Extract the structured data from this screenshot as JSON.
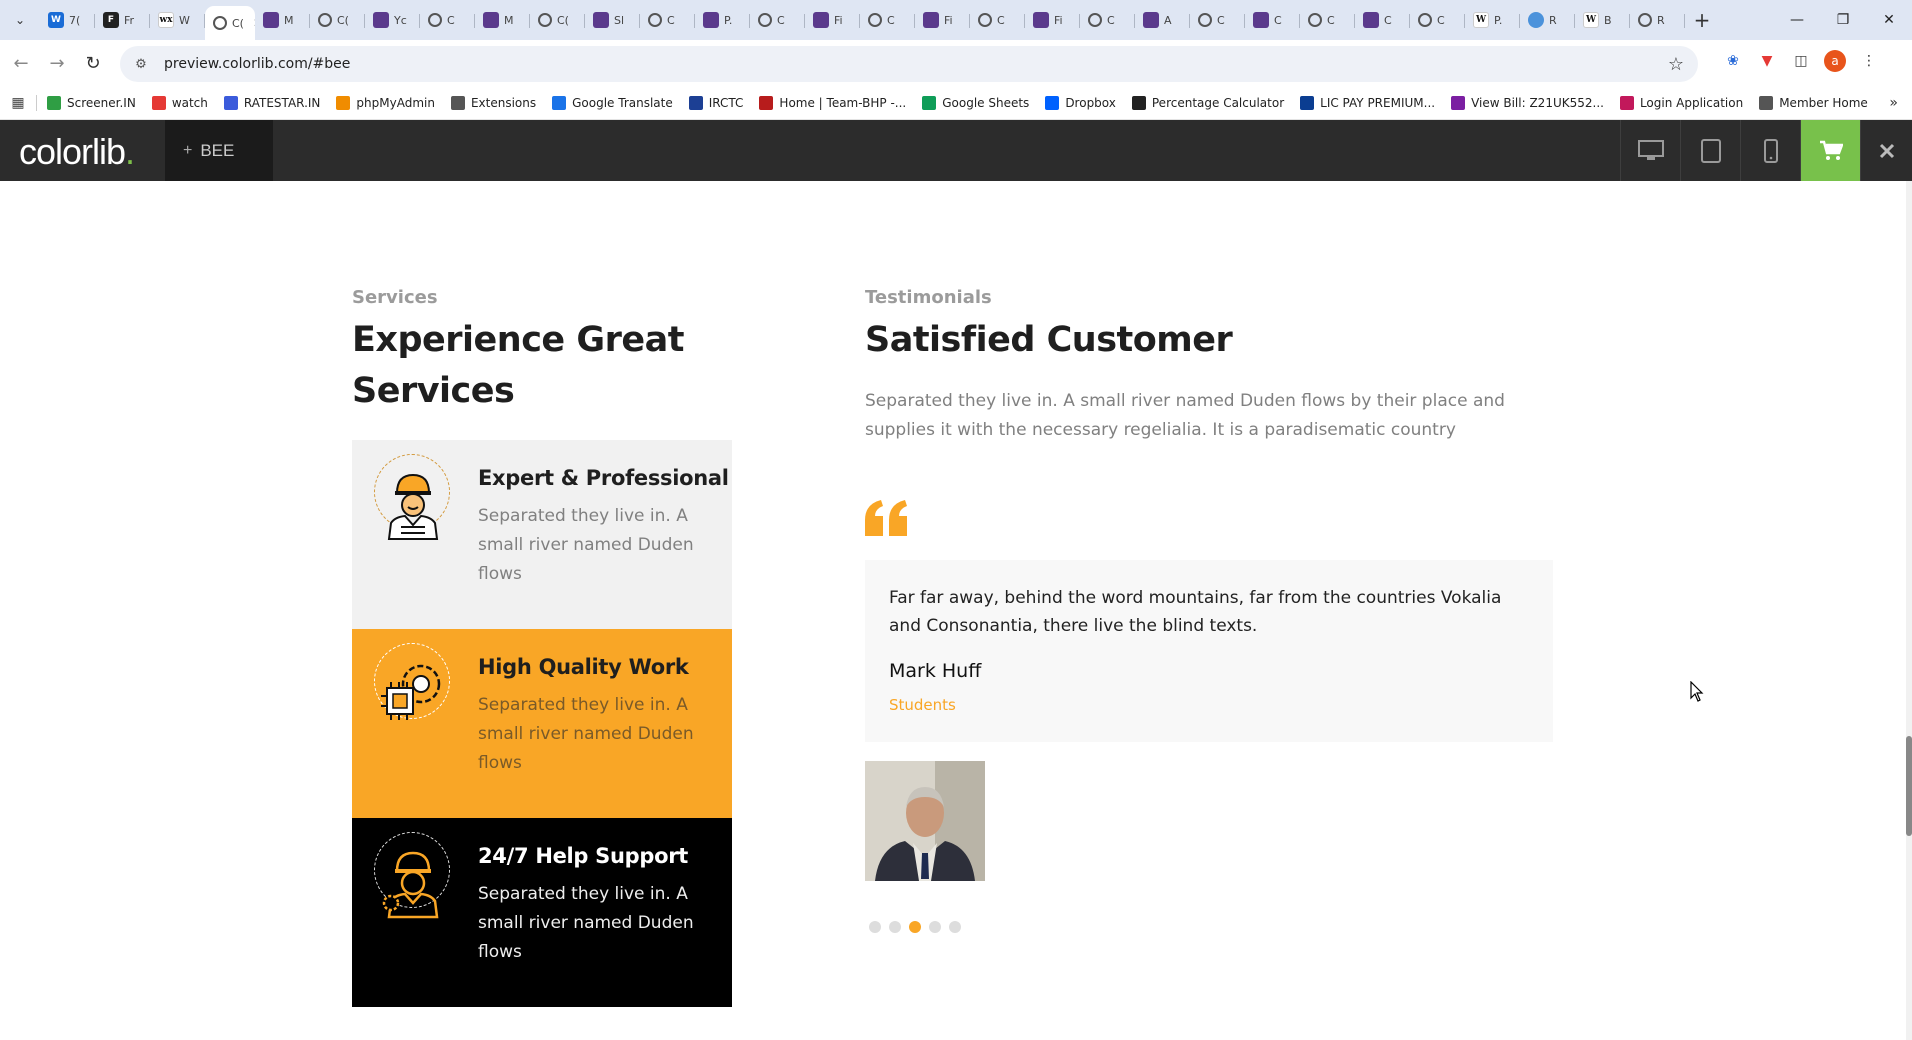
{
  "browser": {
    "tabs": [
      {
        "label": "7(",
        "icon": "outlook-icon"
      },
      {
        "label": "Fr",
        "icon": "feedly-icon"
      },
      {
        "label": "W",
        "icon": "wix-icon"
      },
      {
        "label": "C(",
        "icon": "colorlib-icon",
        "active": true
      },
      {
        "label": "M",
        "icon": "colorlib-icon"
      },
      {
        "label": "C(",
        "icon": "globe-icon"
      },
      {
        "label": "Yc",
        "icon": "colorlib-icon"
      },
      {
        "label": "C",
        "icon": "globe-icon"
      },
      {
        "label": "M",
        "icon": "colorlib-icon"
      },
      {
        "label": "C(",
        "icon": "globe-icon"
      },
      {
        "label": "Sl",
        "icon": "colorlib-icon"
      },
      {
        "label": "C",
        "icon": "globe-icon"
      },
      {
        "label": "P.",
        "icon": "colorlib-icon"
      },
      {
        "label": "C",
        "icon": "globe-icon"
      },
      {
        "label": "Fi",
        "icon": "colorlib-icon"
      },
      {
        "label": "C",
        "icon": "globe-icon"
      },
      {
        "label": "Fi",
        "icon": "colorlib-icon"
      },
      {
        "label": "C",
        "icon": "globe-icon"
      },
      {
        "label": "Fi",
        "icon": "colorlib-icon"
      },
      {
        "label": "C",
        "icon": "globe-icon"
      },
      {
        "label": "A",
        "icon": "colorlib-icon"
      },
      {
        "label": "C",
        "icon": "globe-icon"
      },
      {
        "label": "C",
        "icon": "colorlib-icon"
      },
      {
        "label": "C",
        "icon": "globe-icon"
      },
      {
        "label": "C",
        "icon": "colorlib-icon"
      },
      {
        "label": "C",
        "icon": "globe-icon"
      },
      {
        "label": "P.",
        "icon": "wikipedia-icon"
      },
      {
        "label": "R",
        "icon": "un-icon"
      },
      {
        "label": "B",
        "icon": "wikipedia-icon"
      },
      {
        "label": "R",
        "icon": "globe-icon"
      }
    ],
    "url": "preview.colorlib.com/#bee",
    "avatar_letter": "a",
    "bookmarks": [
      {
        "label": "Screener.IN",
        "color": "#2f9e44"
      },
      {
        "label": "watch",
        "color": "#e53935"
      },
      {
        "label": "RATESTAR.IN",
        "color": "#3b5bdb"
      },
      {
        "label": "phpMyAdmin",
        "color": "#f08c00"
      },
      {
        "label": "Extensions",
        "color": "#555555"
      },
      {
        "label": "Google Translate",
        "color": "#1a73e8"
      },
      {
        "label": "IRCTC",
        "color": "#1c3f94"
      },
      {
        "label": "Home | Team-BHP -...",
        "color": "#b71c1c"
      },
      {
        "label": "Google Sheets",
        "color": "#0f9d58"
      },
      {
        "label": "Dropbox",
        "color": "#0061fe"
      },
      {
        "label": "Percentage Calculator",
        "color": "#222222"
      },
      {
        "label": "LIC PAY PREMIUM...",
        "color": "#0b3d91"
      },
      {
        "label": "View Bill: Z21UK552...",
        "color": "#7b1fa2"
      },
      {
        "label": "Login Application",
        "color": "#c2185b"
      },
      {
        "label": "Member Home",
        "color": "#555555"
      }
    ]
  },
  "preview_bar": {
    "logo": "colorlib",
    "logo_dot": ".",
    "theme_name": "BEE",
    "theme_plus": "+",
    "accent": "#78c14b"
  },
  "services": {
    "subtitle": "Services",
    "title_line1": "Experience Great",
    "title_line2": "Services",
    "items": [
      {
        "title": "Expert & Professional",
        "text": "Separated they live in. A small river named Duden flows"
      },
      {
        "title": "High Quality Work",
        "text": "Separated they live in. A small river named Duden flows"
      },
      {
        "title": "24/7 Help Support",
        "text": "Separated they live in. A small river named Duden flows"
      }
    ]
  },
  "testimonials": {
    "subtitle": "Testimonials",
    "title": "Satisfied Customer",
    "intro": "Separated they live in. A small river named Duden flows by their place and supplies it with the necessary regelialia. It is a paradisematic country",
    "quote": "Far far away, behind the word mountains, far from the countries Vokalia and Consonantia, there live the blind texts.",
    "name": "Mark Huff",
    "role": "Students",
    "dots_count": 5,
    "active_dot_index": 2,
    "accent": "#f9a626"
  }
}
